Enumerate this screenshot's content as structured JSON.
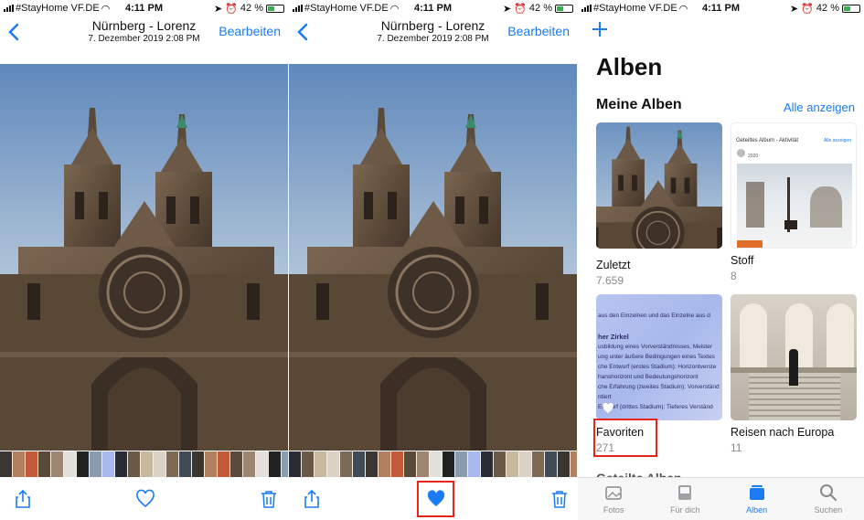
{
  "status": {
    "carrier": "#StayHome VF.DE",
    "time": "4:11 PM",
    "battery": "42 %"
  },
  "viewer": {
    "title": "Nürnberg - Lorenz",
    "subtitle": "7. Dezember 2019  2:08 PM",
    "edit_label": "Bearbeiten",
    "back_icon": "chevron-left-icon",
    "toolbar_icons": [
      "share-icon",
      "heart-icon",
      "trash-icon"
    ]
  },
  "albums": {
    "title": "Alben",
    "section_title": "Meine Alben",
    "see_all_label": "Alle anzeigen",
    "items": [
      {
        "name": "Zuletzt",
        "count": "7.659"
      },
      {
        "name": "Stoff",
        "count": "8"
      },
      {
        "name": "Favoriten",
        "count": "271"
      },
      {
        "name": "Reisen nach Europa",
        "count": "11"
      }
    ],
    "stoff_thumb": {
      "header": "Geteiltes Album - Aktivität",
      "link": "Alle anzeigen",
      "year": "2020"
    },
    "favoriten_thumb": {
      "line1": "aus den Einzelnen und das Einzelne aus d",
      "heading": "her Zirkel",
      "lines": [
        "usbildung eines Vorverständnisses, Meister",
        "ung unter äußere Bedingungen eines Textes",
        "che Entwurf (erstes Stadium): Horizontverste",
        "hanshorizont und Bedeutungshorizont",
        "che Erfahrung (zweites Stadium): Vorverständ",
        "ntiert",
        "Entwurf (drittes Stadium): Tieferes Verständ"
      ]
    },
    "next_section_peek": "Geteilte Alben",
    "tabs": [
      {
        "label": "Fotos",
        "icon": "photos-icon"
      },
      {
        "label": "Für dich",
        "icon": "for-you-icon"
      },
      {
        "label": "Alben",
        "icon": "albums-icon"
      },
      {
        "label": "Suchen",
        "icon": "search-icon"
      }
    ]
  },
  "colors": {
    "accent": "#1a7bf5",
    "highlight": "#e8251c",
    "muted": "#8a8a8e"
  }
}
